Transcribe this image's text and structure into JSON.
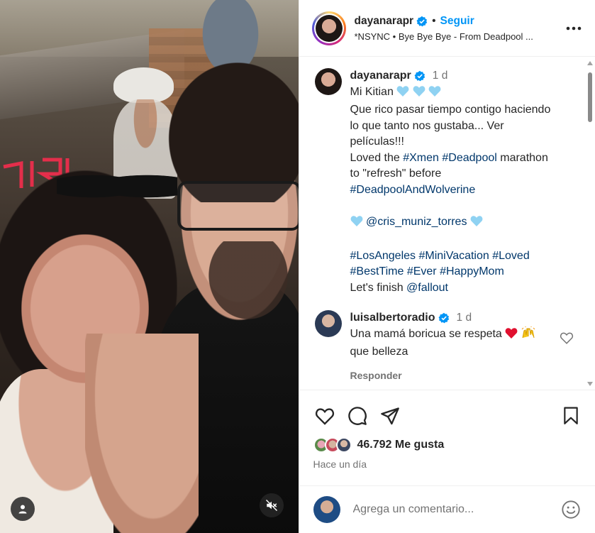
{
  "post": {
    "username": "dayanarapr",
    "follow_label": "Seguir",
    "separator": "•",
    "audio": "*NSYNC • Bye Bye Bye - From Deadpool ...",
    "more_icon": "more-horizontal-icon"
  },
  "caption": {
    "username": "dayanarapr",
    "time": "1 d",
    "line1": "Mi Kitian",
    "line2": "Que rico pasar tiempo contigo haciendo",
    "line3": "lo que tanto nos gustaba... Ver",
    "line4": "películas!!!",
    "line5_pre": "Loved the ",
    "tag_xmen": "#Xmen",
    "tag_deadpool": "#Deadpool",
    "line5_post": " marathon",
    "line6": "to \"refresh\" before",
    "tag_dw": "#DeadpoolAndWolverine",
    "mention_cris": "@cris_muniz_torres",
    "tag_la": "#LosAngeles",
    "tag_mini": "#MiniVacation",
    "tag_loved": "#Loved",
    "tag_besttime": "#BestTime",
    "tag_ever": "#Ever",
    "tag_happymom": "#HappyMom",
    "finish_pre": "Let's finish ",
    "mention_fallout": "@fallout"
  },
  "reply": {
    "username": "luisalbertoradio",
    "time": "1 d",
    "text1": "Una mamá boricua se respeta",
    "text2": "que belleza",
    "reply_label": "Responder"
  },
  "stats": {
    "likes": "46.792 Me gusta",
    "date": "Hace un día"
  },
  "comment_box": {
    "placeholder": "Agrega un comentario..."
  },
  "colors": {
    "link": "#00376b",
    "follow": "#0095f6",
    "verified": "#0095f6",
    "heart_blue": "#8fd2f2",
    "heart_red": "#e0102f",
    "muted": "#737373"
  }
}
